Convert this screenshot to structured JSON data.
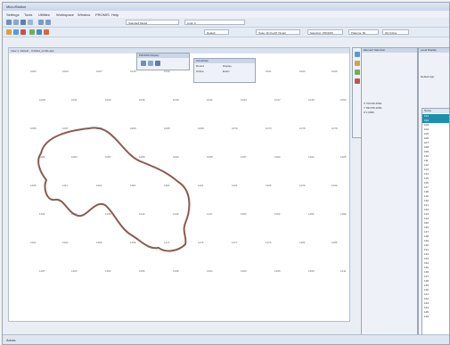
{
  "window": {
    "title": "MicroStation"
  },
  "menu": [
    "Settings",
    "Tools",
    "Utilities",
    "Workspace",
    "Window",
    "PROMIS",
    "Help"
  ],
  "toolbar": {
    "level_combo": "Default",
    "model_combo": "Standard Model",
    "style_combo": "Color 0",
    "field1": "Snap: 3D KeyPt (Snap)",
    "field2": "Selection: PROMIS",
    "field3": "Patterns: 50",
    "field4": "3D Online"
  },
  "view": {
    "title": "View 1, Default - Untitled_profile.dgn"
  },
  "promis_dialog": {
    "title": "PROMIS Display"
  },
  "accudraw": {
    "title": "AccuDraw",
    "options": [
      "Round",
      "Display",
      "Online",
      "Exact"
    ]
  },
  "elem_panel": {
    "title": "Element Selection",
    "xyz": [
      "X   703736.2564",
      "Y   691795.2060",
      "Z   2.0000"
    ]
  },
  "right_panel": {
    "title": "Level Display",
    "field": "Default.dgn"
  },
  "table_panel": {
    "header": "Name",
    "rows": [
      "101",
      "102",
      "103",
      "104",
      "105",
      "106",
      "107",
      "108",
      "109",
      "110",
      "111",
      "112",
      "113",
      "114",
      "115",
      "116",
      "117",
      "118",
      "119",
      "120",
      "121",
      "122",
      "123",
      "124",
      "125",
      "126",
      "127",
      "128",
      "129",
      "130",
      "131",
      "132",
      "133",
      "134",
      "135",
      "136",
      "137",
      "138",
      "139",
      "140",
      "141",
      "142",
      "143",
      "144",
      "145",
      "146"
    ]
  },
  "status": {
    "left": "Areas"
  },
  "colors": {
    "accent": "#2f6fb3",
    "selection": "#1b8fb0",
    "contour": "#8a5a50"
  },
  "points": [
    "1002",
    "1004",
    "1007",
    "1010",
    "1012",
    "1015",
    "1018",
    "1021",
    "1023",
    "1026",
    "1028",
    "1031",
    "1033",
    "1036",
    "1039",
    "1041",
    "1044",
    "1047",
    "1049",
    "1052",
    "1055",
    "1057",
    "1060",
    "1063",
    "1065",
    "1068",
    "1070",
    "1073",
    "1076",
    "1079",
    "1081",
    "1084",
    "1087",
    "1089",
    "1092",
    "1095",
    "1097",
    "1100",
    "1103",
    "1105",
    "1108",
    "1111",
    "1113",
    "1116",
    "1118",
    "1121",
    "1124",
    "1126",
    "1129",
    "1132",
    "1134",
    "1137",
    "1139",
    "1142",
    "1145",
    "1147",
    "1150",
    "1153",
    "1155",
    "1158",
    "1161",
    "1163",
    "1166",
    "1169",
    "1171",
    "1174",
    "1177",
    "1179",
    "1182",
    "1185",
    "1187",
    "1190",
    "1193",
    "1195",
    "1198",
    "1201",
    "1203",
    "1206",
    "1209",
    "1211"
  ]
}
